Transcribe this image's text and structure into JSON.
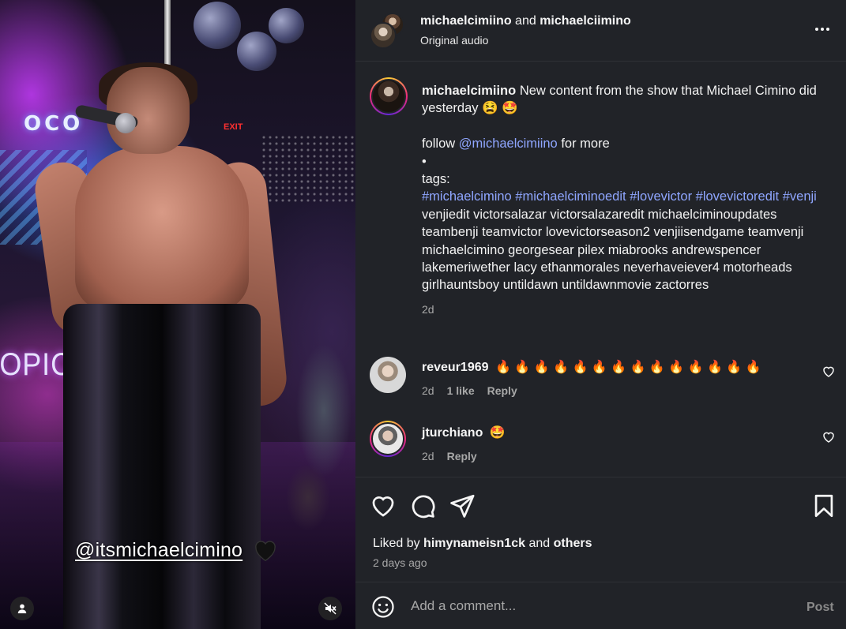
{
  "media": {
    "overlay_tag": "@itsmichaelcimino",
    "overlay_emoji": "black-heart",
    "backdrop_text_top": "OCO",
    "backdrop_text_side": "OPICANA",
    "exit_sign": "EXIT"
  },
  "header": {
    "user1": "michaelcimiino",
    "conjunction": "and",
    "user2": "michaelciimino",
    "subtitle": "Original audio"
  },
  "caption": {
    "username": "michaelcimiino",
    "text_line1": "New content from the show that Michael Cimino did yesterday",
    "emojis": "😫 🤩",
    "follow_prefix": "follow",
    "follow_handle": "@michaelcimiino",
    "follow_suffix": "for more",
    "bullet": "•",
    "tags_label": "tags:",
    "hashtags": "#michaelcimino #michaelciminoedit #lovevictor #lovevictoredit",
    "hashtag_venji": "#venji",
    "plain_tags": "venjiedit victorsalazar victorsalazaredit michaelciminoupdates teambenji teamvictor lovevictorseason2 venjiisendgame teamvenji michaelcimino georgesear pilex miabrooks andrewspencer lakemeriwether lacy ethanmorales neverhaveiever4 motorheads girlhauntsboy untildawn untildawnmovie zactorres",
    "time": "2d"
  },
  "comments": [
    {
      "username": "reveur1969",
      "text": "🔥 🔥 🔥 🔥 🔥 🔥 🔥 🔥 🔥 🔥 🔥 🔥 🔥 🔥",
      "time": "2d",
      "likes": "1 like",
      "reply": "Reply"
    },
    {
      "username": "jturchiano",
      "text": "🤩",
      "time": "2d",
      "reply": "Reply"
    }
  ],
  "likes": {
    "prefix": "Liked by",
    "user": "himynameisn1ck",
    "middle": "and",
    "others": "others",
    "ago": "2 days ago"
  },
  "add_comment": {
    "placeholder": "Add a comment...",
    "post_label": "Post"
  },
  "colors": {
    "panel_bg": "#212328",
    "link": "#8fa6ff",
    "muted": "#a8a8a8"
  }
}
